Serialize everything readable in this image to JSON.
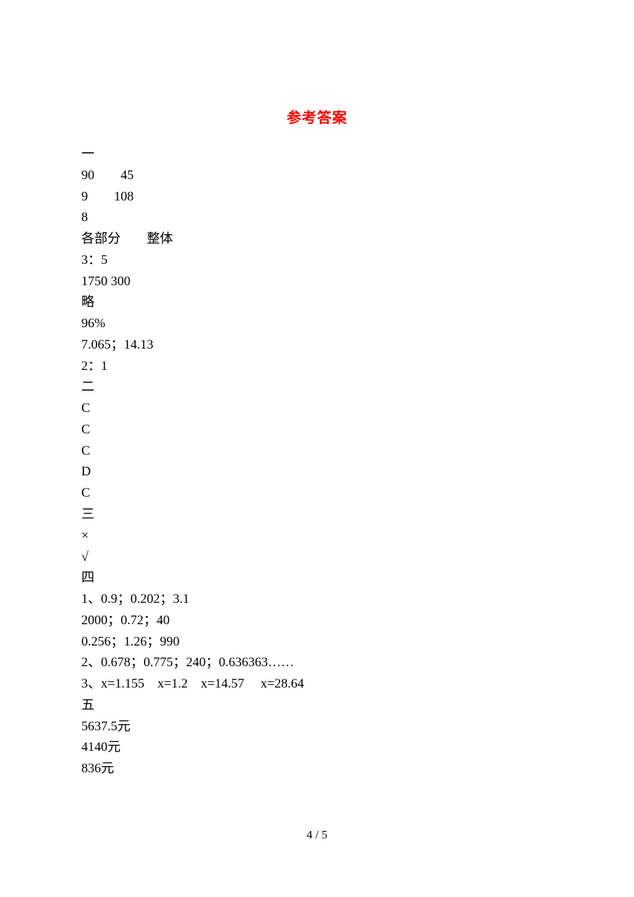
{
  "title": "参考答案",
  "lines": [
    "一",
    "90　　45",
    "9　　108",
    "8",
    "各部分　　整体",
    "3：5",
    "1750 300",
    "略",
    "96%",
    "7.065；14.13",
    "2：1",
    "二",
    "C",
    "C",
    "C",
    "D",
    "C",
    "三",
    "×",
    "√",
    "四",
    "1、0.9；0.202；3.1",
    "2000；0.72；40",
    "0.256；1.26；990",
    "2、0.678；0.775；240；0.636363……",
    "3、x=1.155    x=1.2    x=14.57     x=28.64",
    "五",
    "5637.5元",
    "4140元",
    "836元"
  ],
  "pageNumber": "4 / 5"
}
